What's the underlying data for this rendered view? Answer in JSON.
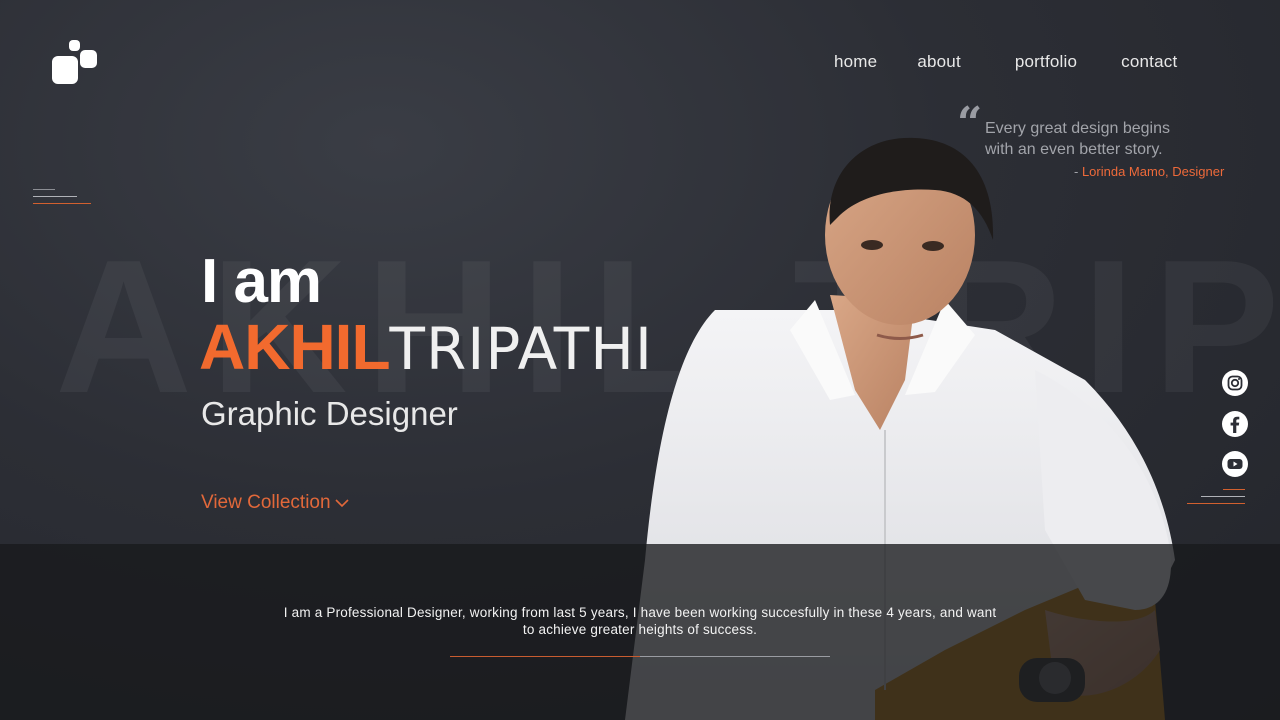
{
  "nav": {
    "items": [
      "home",
      "about",
      "portfolio",
      "contact"
    ]
  },
  "background_name": "AKHIL TRIPATHI",
  "quote": {
    "mark": "“",
    "line1": "Every great design begins",
    "line2": "with an even better story.",
    "author_prefix": "- ",
    "author": "Lorinda Mamo, Designer"
  },
  "hero": {
    "intro": "I am",
    "first_name": "AKHIL",
    "last_name": "TRIPATHI",
    "role": "Graphic Designer",
    "cta_label": "View Collection"
  },
  "social": {
    "icons": [
      "instagram-icon",
      "facebook-icon",
      "youtube-icon"
    ]
  },
  "bio": {
    "line1": "I am a Professional Designer, working from last 5 years, I have been working succesfully in these 4 years, and want",
    "line2": "to achieve greater heights of success."
  },
  "colors": {
    "accent": "#f26a2e",
    "background": "#2c2e35",
    "band": "#18191c"
  }
}
